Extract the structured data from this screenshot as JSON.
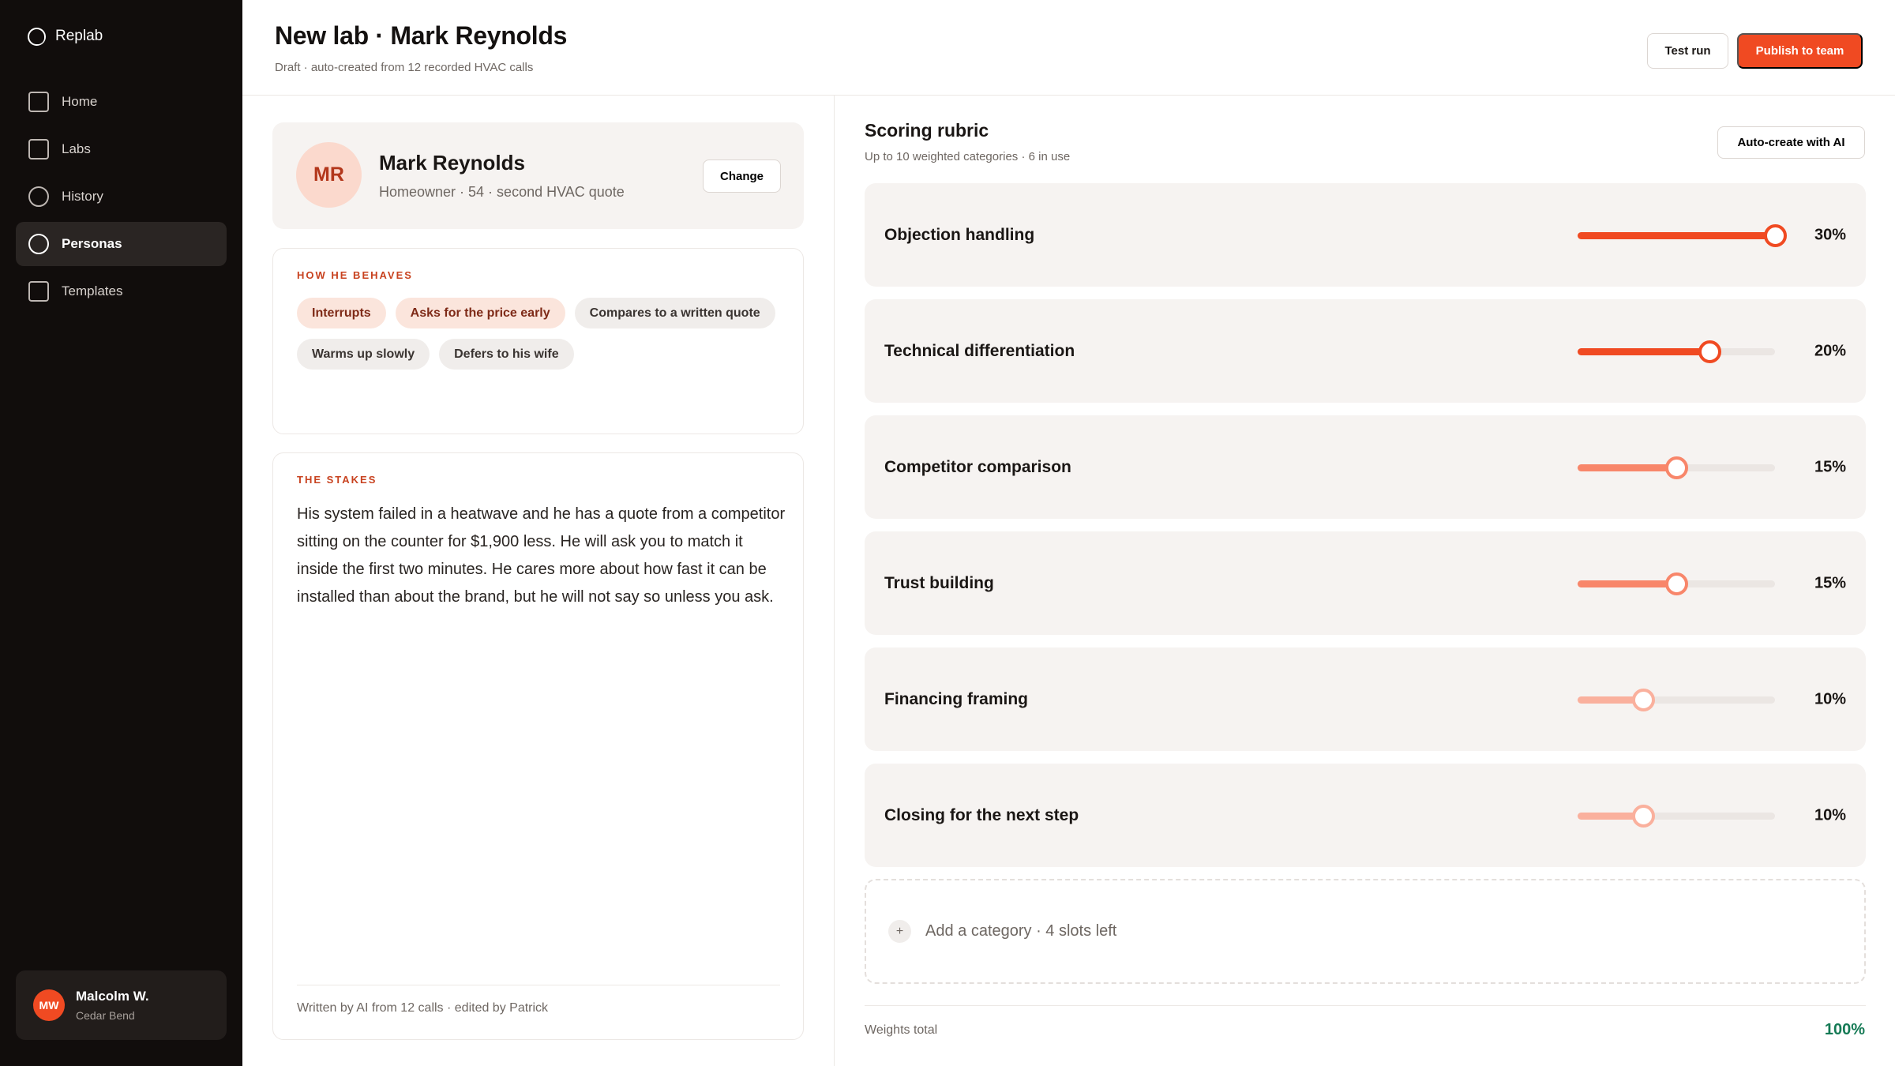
{
  "app": {
    "brand": "Replab"
  },
  "sidebar": {
    "items": [
      {
        "label": "Home",
        "icon": "home-icon",
        "active": false
      },
      {
        "label": "Labs",
        "icon": "labs-icon",
        "active": false
      },
      {
        "label": "History",
        "icon": "history-icon",
        "active": false
      },
      {
        "label": "Personas",
        "icon": "personas-icon",
        "active": true
      },
      {
        "label": "Templates",
        "icon": "templates-icon",
        "active": false
      }
    ],
    "user": {
      "initials": "MW",
      "name": "Malcolm W.",
      "org": "Cedar Bend"
    }
  },
  "header": {
    "title": "New lab · Mark Reynolds",
    "subtitle": "Draft · auto-created from 12 recorded HVAC calls",
    "test_run_label": "Test run",
    "publish_label": "Publish to team"
  },
  "persona": {
    "initials": "MR",
    "name": "Mark Reynolds",
    "meta": "Homeowner · 54 · second HVAC quote",
    "change_label": "Change"
  },
  "behaviors": {
    "label": "HOW HE BEHAVES",
    "chips": [
      {
        "label": "Interrupts",
        "tone": "hot"
      },
      {
        "label": "Asks for the price early",
        "tone": "hot"
      },
      {
        "label": "Compares to a written quote",
        "tone": "neutral"
      },
      {
        "label": "Warms up slowly",
        "tone": "neutral"
      },
      {
        "label": "Defers to his wife",
        "tone": "neutral"
      }
    ]
  },
  "stakes": {
    "label": "THE STAKES",
    "text": "His system failed in a heatwave and he has a quote from a competitor sitting on the counter for $1,900 less. He will ask you to match it inside the first two minutes. He cares more about how fast it can be installed than about the brand, but he will not say so unless you ask.",
    "footer": "Written by AI from 12 calls · edited by Patrick"
  },
  "rubric": {
    "title": "Scoring rubric",
    "subtitle": "Up to 10 weighted categories · 6 in use",
    "auto_create_label": "Auto-create with AI",
    "slider_max": 30,
    "categories": [
      {
        "label": "Objection handling",
        "weight": 30,
        "weight_label": "30%",
        "color": "#f04a22"
      },
      {
        "label": "Technical differentiation",
        "weight": 20,
        "weight_label": "20%",
        "color": "#f04a22"
      },
      {
        "label": "Competitor comparison",
        "weight": 15,
        "weight_label": "15%",
        "color": "#f8866a"
      },
      {
        "label": "Trust building",
        "weight": 15,
        "weight_label": "15%",
        "color": "#f8866a"
      },
      {
        "label": "Financing framing",
        "weight": 10,
        "weight_label": "10%",
        "color": "#fab09d"
      },
      {
        "label": "Closing for the next step",
        "weight": 10,
        "weight_label": "10%",
        "color": "#fab09d"
      }
    ],
    "add_label": "Add a category · 4 slots left",
    "add_icon": "+",
    "total_label": "Weights total",
    "total_value": "100%"
  },
  "colors": {
    "accent": "#f04a22",
    "total": "#157a55",
    "sidebar": "#110d0c"
  }
}
